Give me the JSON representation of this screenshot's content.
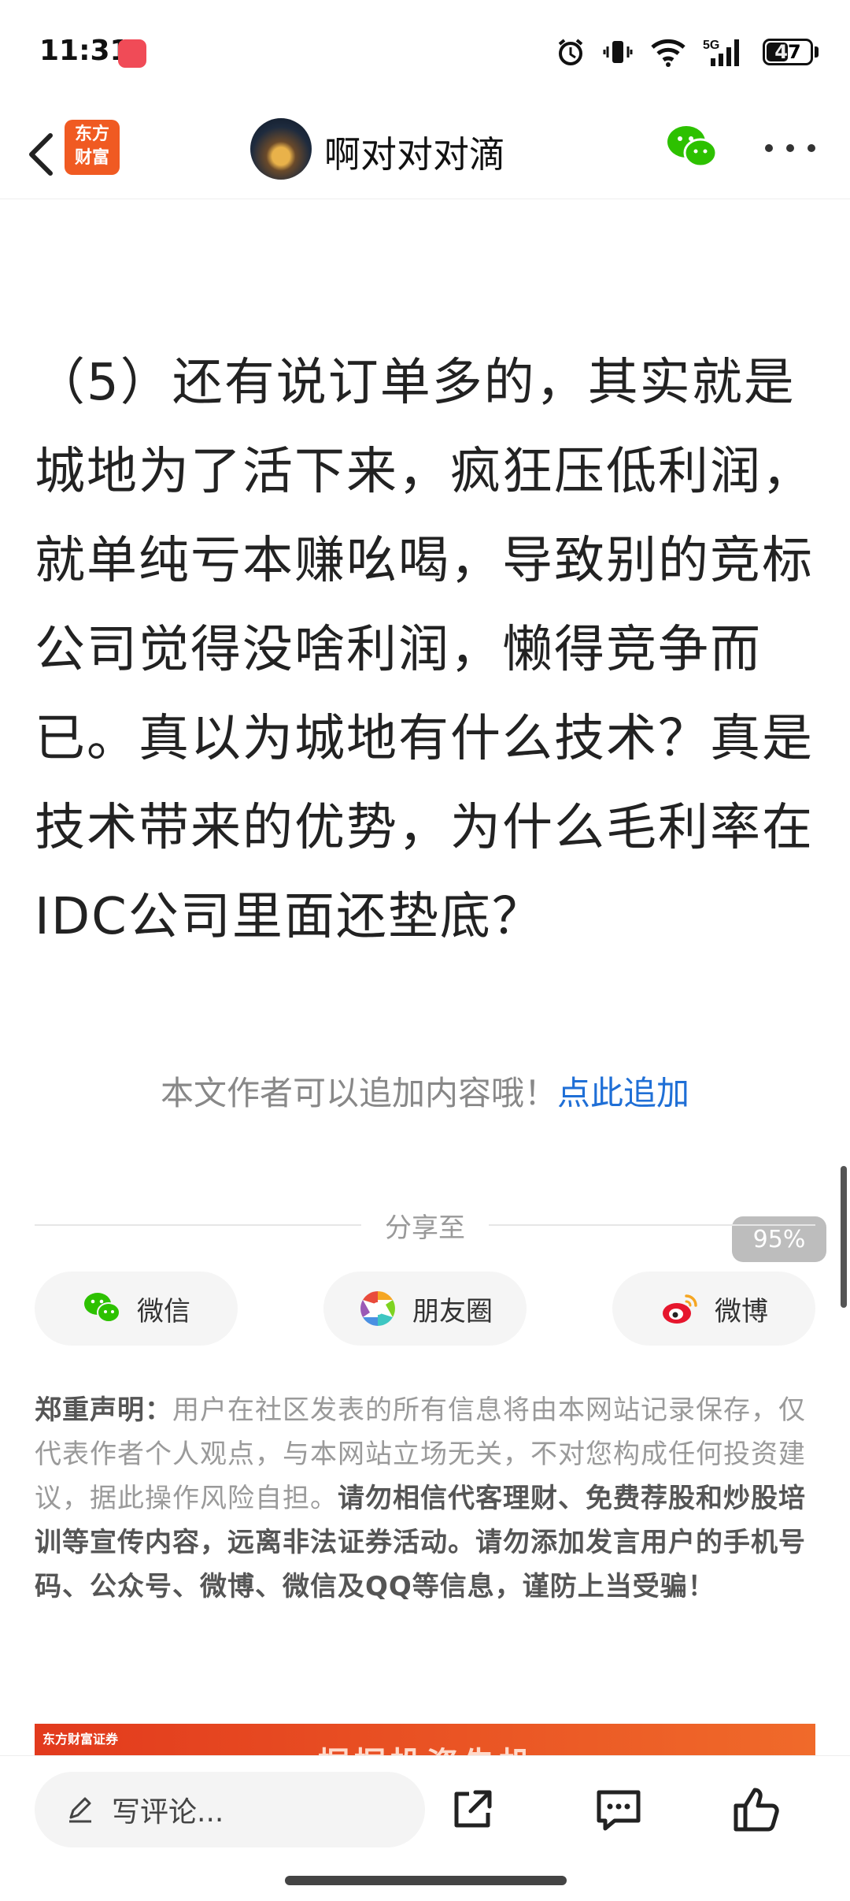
{
  "status_bar": {
    "time": "11:31",
    "battery": "47",
    "network": "5G"
  },
  "nav": {
    "brand_line1": "东方",
    "brand_line2": "财富",
    "user_name": "啊对对对滴"
  },
  "article": {
    "paragraph": "（5）还有说订单多的，其实就是城地为了活下来，疯狂压低利润，就单纯亏本赚吆喝，导致别的竞标公司觉得没啥利润，懒得竞争而已。真以为城地有什么技术？真是技术带来的优势，为什么毛利率在IDC公司里面还垫底？"
  },
  "append": {
    "text": "本文作者可以追加内容哦！",
    "link": "点此追加"
  },
  "scroll": {
    "percent_label": "95%"
  },
  "share": {
    "title": "分享至",
    "items": [
      {
        "label": "微信",
        "icon": "wechat-icon"
      },
      {
        "label": "朋友圈",
        "icon": "moments-icon"
      },
      {
        "label": "微博",
        "icon": "weibo-icon"
      }
    ]
  },
  "disclaimer": {
    "heading": "郑重声明：",
    "normal": "用户在社区发表的所有信息将由本网站记录保存，仅代表作者个人观点，与本网站立场无关，不对您构成任何投资建议，据此操作风险自担。",
    "bold": "请勿相信代客理财、免费荐股和炒股培训等宣传内容，远离非法证券活动。请勿添加发言用户的手机号码、公众号、微博、微信及QQ等信息，谨防上当受骗！"
  },
  "banner": {
    "logo_text": "东方财富证券",
    "title": "掘掘投资先机"
  },
  "bottom_bar": {
    "comment_placeholder": "写评论..."
  },
  "colors": {
    "link": "#1f6fd6",
    "brand": "#f05a22",
    "wechat_green": "#2dc100"
  }
}
